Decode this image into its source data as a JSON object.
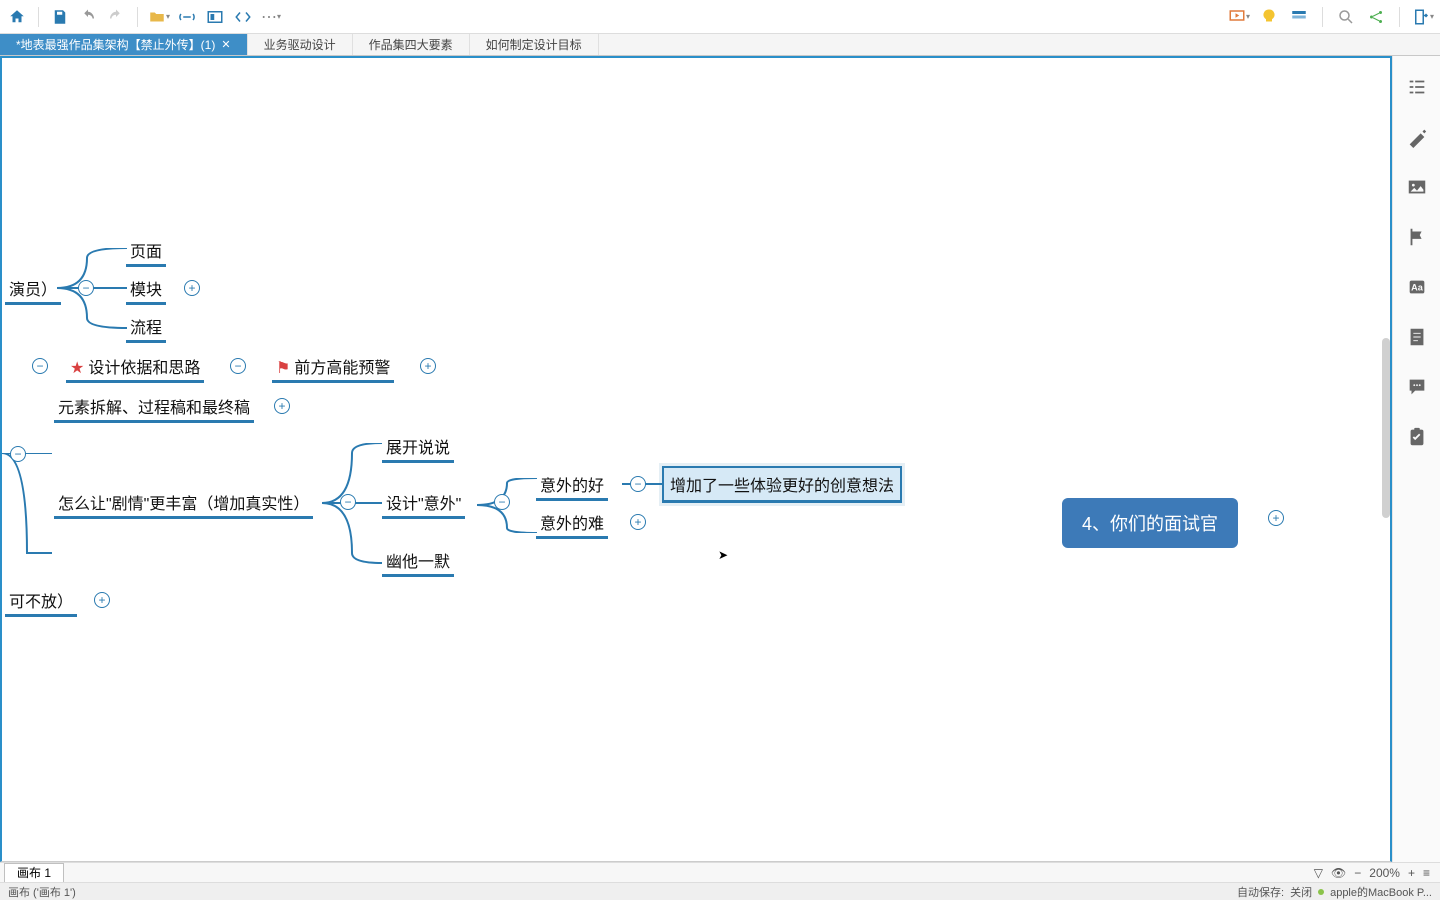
{
  "toolbar": {
    "icons": [
      "home",
      "save",
      "undo",
      "redo",
      "open",
      "link",
      "view",
      "code",
      "more"
    ],
    "right_icons": [
      "present",
      "idea",
      "layout",
      "search",
      "share",
      "export"
    ]
  },
  "tabs": [
    {
      "label": "*地表最强作品集架构【禁止外传】(1)",
      "active": true,
      "closable": true
    },
    {
      "label": "业务驱动设计",
      "active": false
    },
    {
      "label": "作品集四大要素",
      "active": false
    },
    {
      "label": "如何制定设计目标",
      "active": false
    }
  ],
  "side_icons": [
    "outline",
    "style",
    "image",
    "flag",
    "text",
    "note",
    "comment",
    "task"
  ],
  "mindmap": {
    "nodes": {
      "actor": {
        "text": "演员）"
      },
      "page": {
        "text": "页面"
      },
      "module": {
        "text": "模块"
      },
      "process": {
        "text": "流程"
      },
      "basis": {
        "text": "设计依据和思路",
        "marker": "star"
      },
      "warning": {
        "text": "前方高能预警",
        "marker": "flag"
      },
      "elements": {
        "text": "元素拆解、过程稿和最终稿"
      },
      "richer": {
        "text": "怎么让\"剧情\"更丰富（增加真实性）"
      },
      "optional": {
        "text": "可不放）"
      },
      "expand": {
        "text": "展开说说"
      },
      "surprise": {
        "text": "设计\"意外\""
      },
      "humor": {
        "text": "幽他一默"
      },
      "good": {
        "text": "意外的好"
      },
      "hard": {
        "text": "意外的难"
      },
      "ideas": {
        "text": "增加了一些体验更好的创意想法",
        "selected": true
      },
      "main": {
        "text": "4、你们的面试官"
      }
    }
  },
  "sheet": {
    "tabs": [
      "画布 1"
    ],
    "breadcrumb": "画布 ('画布 1')"
  },
  "zoombar": {
    "zoom": "200%",
    "icons": [
      "filter",
      "eye",
      "minus",
      "plus",
      "menu"
    ]
  },
  "status": {
    "autosave_label": "自动保存:",
    "autosave_state": "关闭",
    "device": "apple的MacBook P..."
  }
}
